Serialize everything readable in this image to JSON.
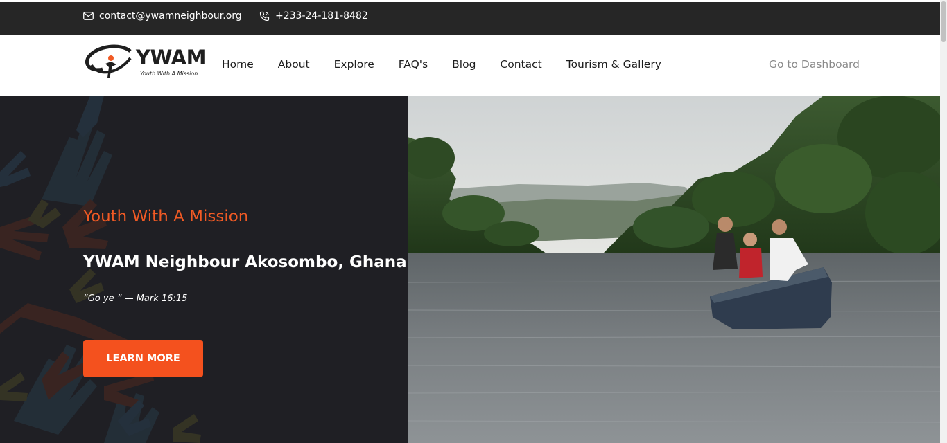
{
  "topbar": {
    "email": "contact@ywamneighbour.org",
    "phone": "+233-24-181-8482",
    "icons": {
      "email": "envelope-icon",
      "phone": "phone-icon"
    }
  },
  "logo": {
    "word": "YWAM",
    "tagline": "Youth With A Mission"
  },
  "nav": {
    "items": [
      {
        "label": "Home"
      },
      {
        "label": "About"
      },
      {
        "label": "Explore"
      },
      {
        "label": "FAQ's"
      },
      {
        "label": "Blog"
      },
      {
        "label": "Contact"
      },
      {
        "label": "Tourism & Gallery"
      }
    ],
    "dashboard_label": "Go to Dashboard"
  },
  "hero": {
    "subtitle": "Youth With A Mission",
    "title": "YWAM Neighbour Akosombo, Ghana",
    "quote": "“Go ye ” — Mark 16:15",
    "button_label": "LEARN MORE"
  },
  "colors": {
    "accent": "#f4511e",
    "topbar_bg": "#262626",
    "hero_dark": "#1f1f24"
  }
}
